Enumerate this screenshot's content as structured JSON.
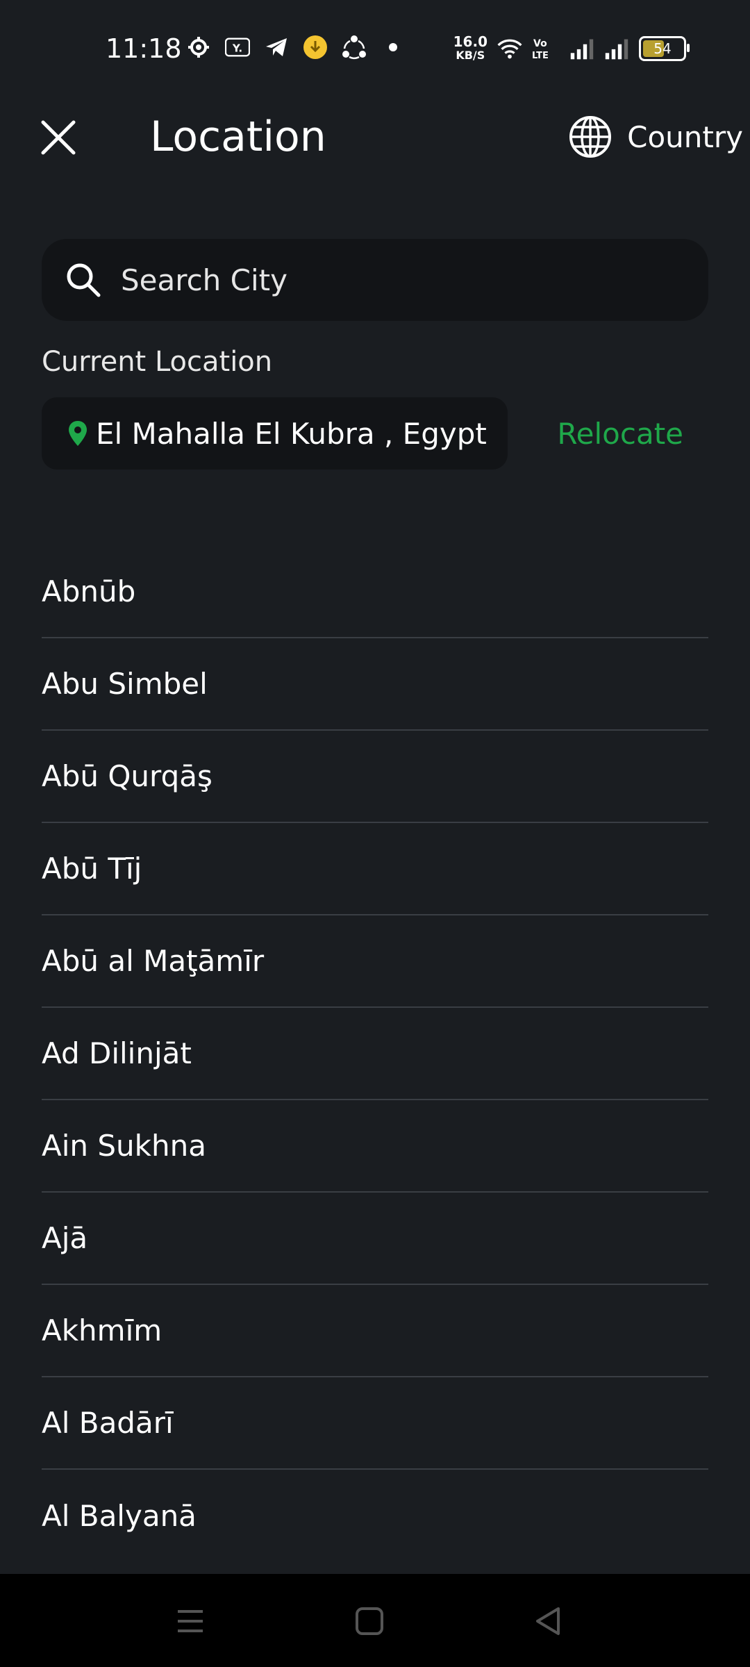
{
  "status_bar": {
    "time": "11:18",
    "speed_value": "16.0",
    "speed_unit": "KB/S",
    "volte": "Vo LTE",
    "battery": "54",
    "icons": [
      "settings-icon",
      "yahoo-icon",
      "telegram-icon",
      "download-badge-icon",
      "share-icon",
      "dot-icon",
      "wifi-icon",
      "signal-icon",
      "signal-icon"
    ]
  },
  "header": {
    "title": "Location",
    "country_label": "Country",
    "close_icon": "close-icon",
    "globe_icon": "globe-icon"
  },
  "search": {
    "placeholder": "Search City"
  },
  "current_location": {
    "label": "Current Location",
    "value": "El Mahalla El Kubra , Egypt",
    "relocate_label": "Relocate"
  },
  "cities": [
    "Abnūb",
    "Abu Simbel",
    "Abū Qurqāş",
    "Abū Tīj",
    "Abū al Maţāmīr",
    "Ad Dilinjāt",
    "Ain Sukhna",
    "Ajā",
    "Akhmīm",
    "Al Badārī",
    "Al Balyanā"
  ],
  "colors": {
    "background": "#1a1d21",
    "field": "#121417",
    "accent_green": "#1fa84a",
    "divider": "#3a3e44"
  }
}
